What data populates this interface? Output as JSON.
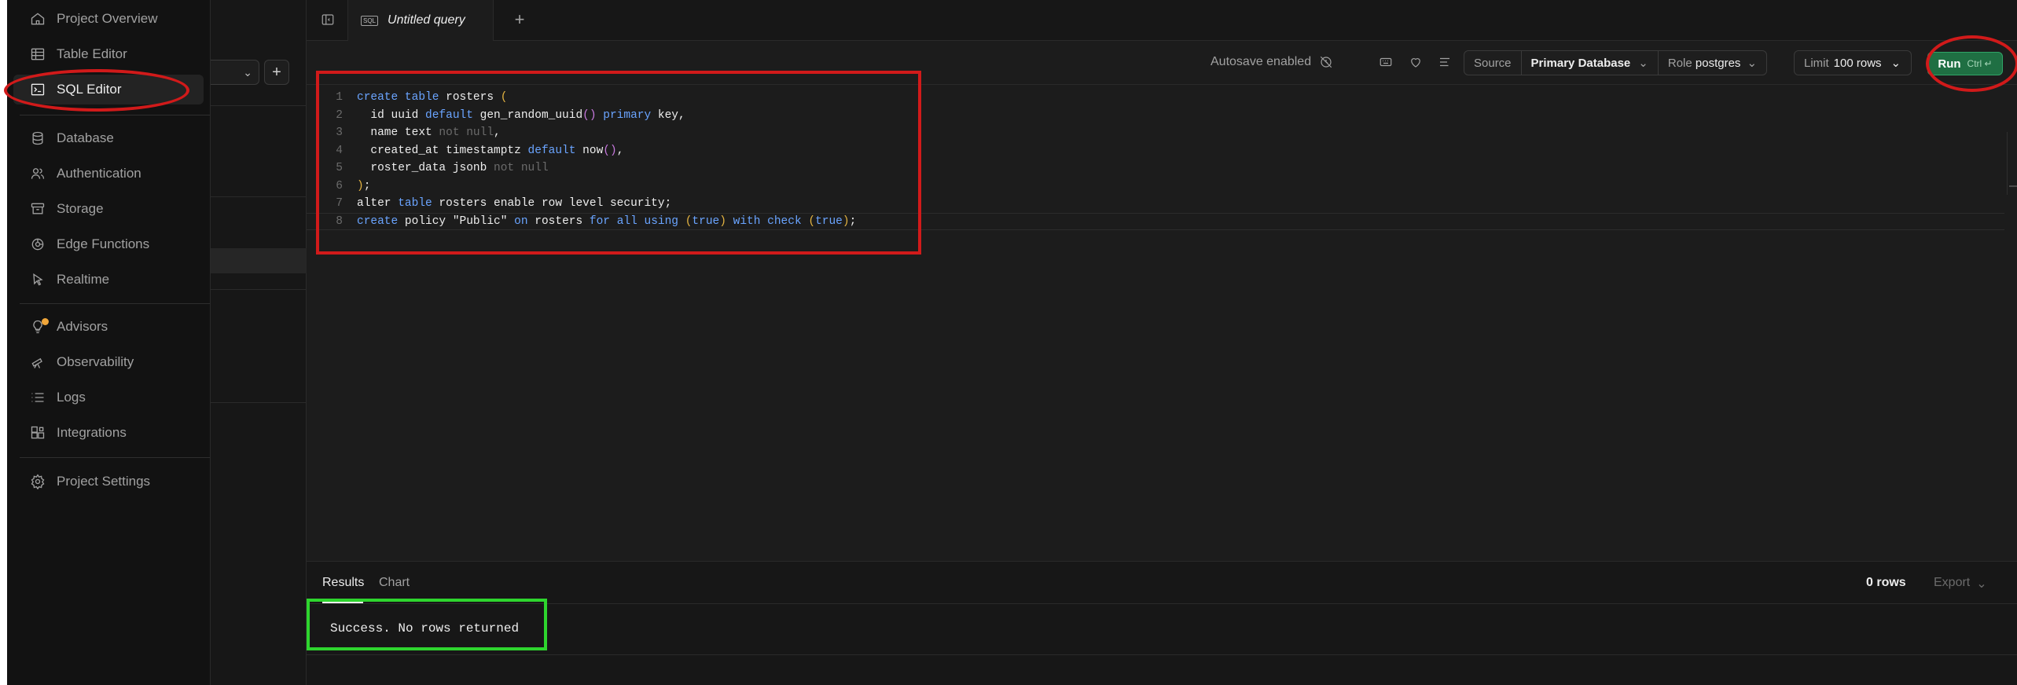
{
  "sidebar": {
    "items": [
      {
        "label": "Project Overview",
        "icon": "home-icon"
      },
      {
        "label": "Table Editor",
        "icon": "table-icon"
      },
      {
        "label": "SQL Editor",
        "icon": "terminal-icon",
        "active": true
      },
      {
        "label": "Database",
        "icon": "database-icon"
      },
      {
        "label": "Authentication",
        "icon": "users-icon"
      },
      {
        "label": "Storage",
        "icon": "archive-icon"
      },
      {
        "label": "Edge Functions",
        "icon": "functions-icon"
      },
      {
        "label": "Realtime",
        "icon": "realtime-icon"
      },
      {
        "label": "Advisors",
        "icon": "lightbulb-icon"
      },
      {
        "label": "Observability",
        "icon": "telescope-icon"
      },
      {
        "label": "Logs",
        "icon": "list-icon"
      },
      {
        "label": "Integrations",
        "icon": "integrations-icon"
      },
      {
        "label": "Project Settings",
        "icon": "gear-icon"
      }
    ]
  },
  "tabs": {
    "query_tab_label": "Untitled query",
    "sql_badge": "SQL",
    "new_tab": "+"
  },
  "toolbar": {
    "autosave": "Autosave enabled",
    "source_label": "Source",
    "database": "Primary Database",
    "role_label": "Role",
    "role_value": "postgres",
    "limit_label": "Limit",
    "limit_value": "100 rows",
    "run_label": "Run",
    "run_shortcut": "Ctrl ↵"
  },
  "editor": {
    "line_numbers": [
      "1",
      "2",
      "3",
      "4",
      "5",
      "6",
      "7",
      "8"
    ]
  },
  "results": {
    "tab_results": "Results",
    "tab_chart": "Chart",
    "rows_count": "0 rows",
    "export_label": "Export",
    "message": "Success. No rows returned"
  },
  "colors": {
    "background": "#1c1c1c",
    "sidebar": "#121212",
    "run_button": "#1f6f43",
    "keyword": "#6aa4ff",
    "annotation_red": "#d11a1a",
    "annotation_green": "#2ed52e"
  }
}
